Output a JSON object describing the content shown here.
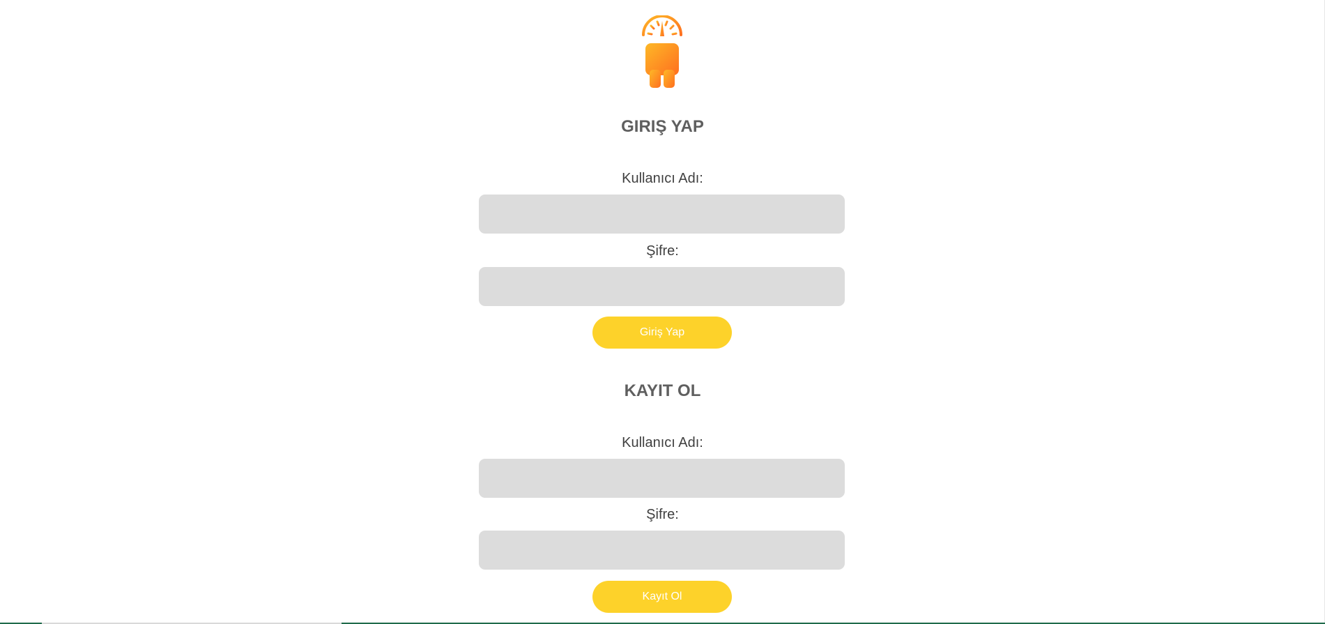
{
  "logo": {
    "icon": "speedometer-person-icon",
    "gradient_start": "#fdb827",
    "gradient_end": "#ff6f1f"
  },
  "login": {
    "title": "GIRIŞ YAP",
    "username_label": "Kullanıcı Adı:",
    "username_value": "",
    "password_label": "Şifre:",
    "password_value": "",
    "submit_label": "Giriş Yap"
  },
  "register": {
    "title": "KAYIT OL",
    "username_label": "Kullanıcı Adı:",
    "username_value": "",
    "password_label": "Şifre:",
    "password_value": "",
    "submit_label": "Kayıt Ol"
  },
  "colors": {
    "button": "#fdd22a",
    "button_text": "#ffffff",
    "input_bg": "#dcdcdc",
    "title_text": "#5f5f5f",
    "label_text": "#3f3f3f"
  }
}
